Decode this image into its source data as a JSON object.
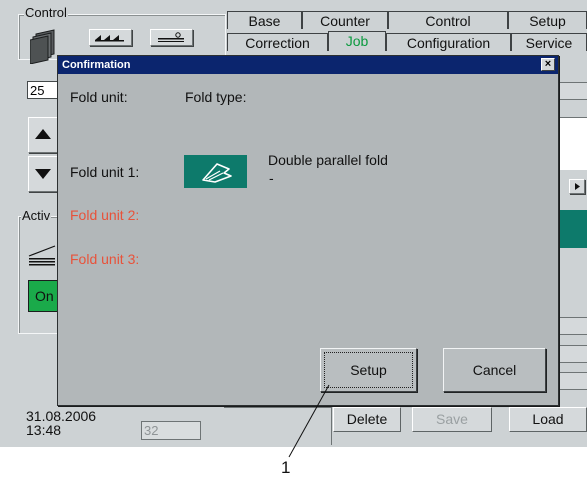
{
  "tabs_row1": [
    "Base",
    "Counter",
    "Control",
    "Setup"
  ],
  "tabs_row2": [
    "Correction",
    "Job",
    "Configuration",
    "Service"
  ],
  "left_panel": {
    "control_group_label": "Control",
    "active_group_label": "Activ",
    "value_field": "25",
    "on_button_label": "On",
    "date": "31.08.2006",
    "time": "13:48",
    "counter_field": "32"
  },
  "bottom_buttons": {
    "delete": "Delete",
    "save": "Save",
    "load": "Load"
  },
  "dialog": {
    "title": "Confirmation",
    "close_glyph": "×",
    "header_col1": "Fold unit:",
    "header_col2": "Fold type:",
    "rows": [
      {
        "label": "Fold unit 1:",
        "type": "Double parallel fold",
        "sub": "-"
      },
      {
        "label": "Fold unit 2:"
      },
      {
        "label": "Fold unit 3:"
      }
    ],
    "setup_button": "Setup",
    "cancel_button": "Cancel"
  },
  "callout_number": "1",
  "colors": {
    "screen_bg": "#cdd2d4",
    "dialog_bg": "#b2b7b9",
    "titlebar": "#0b256e",
    "active_tab": "#0b9a3f",
    "warning_label": "#e8523a",
    "on_button": "#1aaa4a",
    "fold_icon_bg": "#0d7a6b"
  }
}
